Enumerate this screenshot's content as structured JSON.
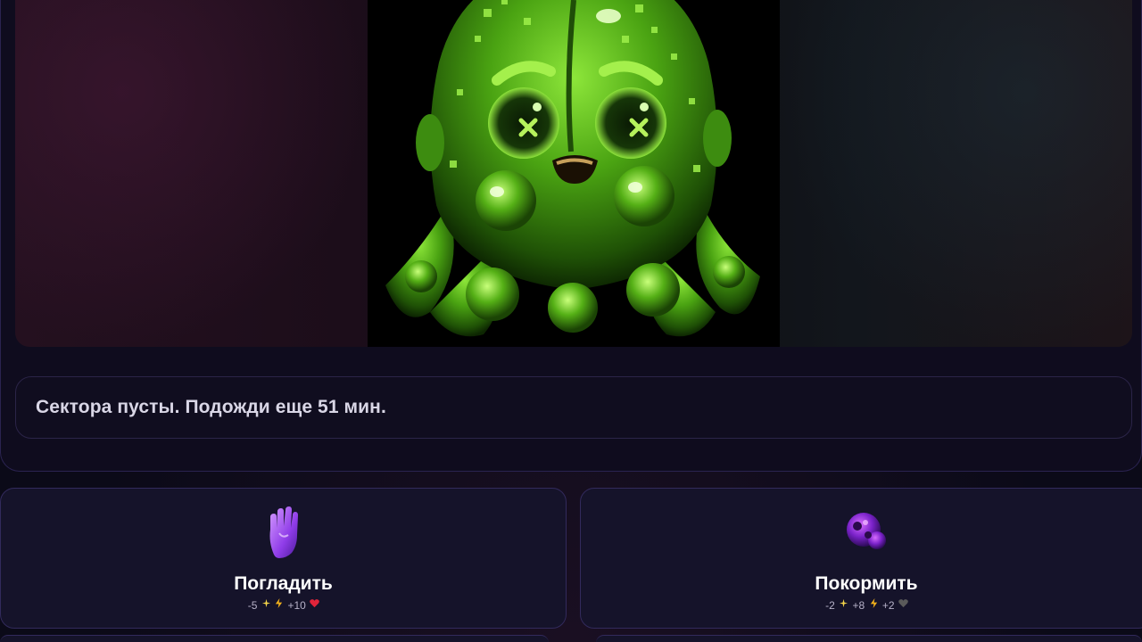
{
  "message": {
    "text": "Сектора пусты. Подожди еще 51 мин."
  },
  "actions": [
    {
      "label": "Погладить",
      "icon": "hand-icon",
      "stats": [
        {
          "value": "-5",
          "icon": "sparkle-icon"
        },
        {
          "value": "",
          "icon": "energy-icon"
        },
        {
          "value": "+10",
          "icon": "heart-icon"
        }
      ]
    },
    {
      "label": "Покормить",
      "icon": "food-icon",
      "stats": [
        {
          "value": "-2",
          "icon": "sparkle-icon"
        },
        {
          "value": "+8",
          "icon": "energy-icon"
        },
        {
          "value": "+2",
          "icon": "heart-icon"
        }
      ]
    }
  ],
  "colors": {
    "slime_green": "#6fd41a",
    "heart_red": "#e0243a",
    "heart_gray": "#5a5a5a",
    "energy_yellow": "#f3b21b",
    "accent_purple": "#7b3fe4"
  }
}
